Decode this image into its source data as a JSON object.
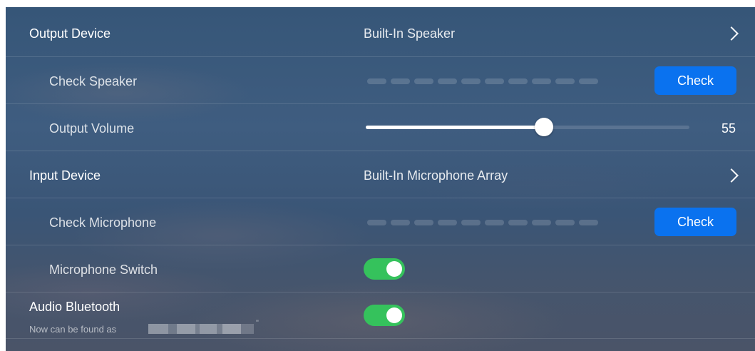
{
  "output_device": {
    "label": "Output Device",
    "value": "Built-In Speaker",
    "icon": "chevron-right-icon"
  },
  "check_speaker": {
    "label": "Check Speaker",
    "button_label": "Check",
    "level_segments": 10
  },
  "output_volume": {
    "label": "Output Volume",
    "value": "55",
    "fraction": 0.55
  },
  "input_device": {
    "label": "Input Device",
    "value": "Built-In Microphone Array",
    "icon": "chevron-right-icon"
  },
  "check_microphone": {
    "label": "Check Microphone",
    "button_label": "Check",
    "level_segments": 10
  },
  "microphone_switch": {
    "label": "Microphone Switch",
    "state": "on"
  },
  "audio_bluetooth": {
    "label": "Audio Bluetooth",
    "discoverable_text": "Now can be found as",
    "quote_mark": "\"",
    "state": "on"
  },
  "colors": {
    "accent_button": "#0a72ef",
    "toggle_on": "#35c25c"
  }
}
